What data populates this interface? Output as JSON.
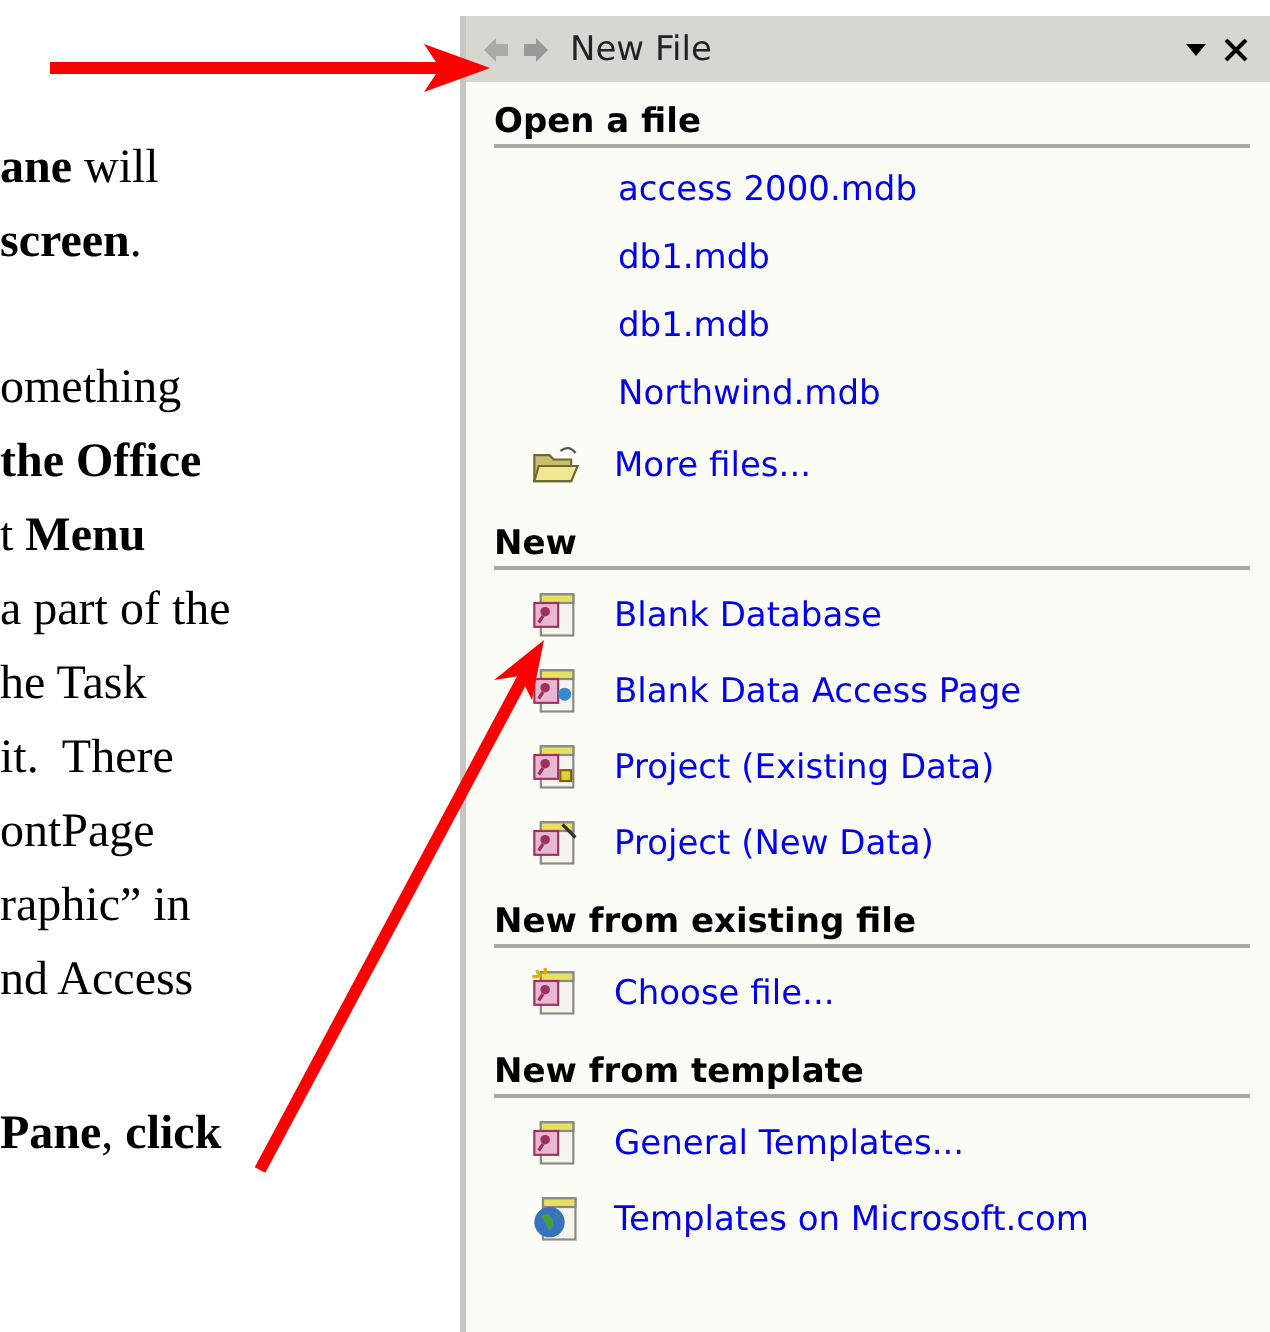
{
  "document": {
    "paragraphs": [
      {
        "lines": [
          "**ane** will",
          "**screen**."
        ]
      },
      {
        "lines": [
          "omething",
          "**the Office**",
          "t **Menu**",
          "a part of the",
          "he Task",
          "it.  There",
          "ontPage",
          "raphic” in",
          "nd Access"
        ]
      },
      {
        "lines": [
          "**Pane**, **click**"
        ]
      }
    ]
  },
  "task_pane": {
    "title": "New File",
    "sections": [
      {
        "heading": "Open a file",
        "items": [
          {
            "label": "access 2000.mdb",
            "kind": "file"
          },
          {
            "label": "db1.mdb",
            "kind": "file"
          },
          {
            "label": "db1.mdb",
            "kind": "file"
          },
          {
            "label": "Northwind.mdb",
            "kind": "file"
          },
          {
            "label": "More files...",
            "kind": "folder"
          }
        ]
      },
      {
        "heading": "New",
        "items": [
          {
            "label": "Blank Database",
            "kind": "database"
          },
          {
            "label": "Blank Data Access Page",
            "kind": "data-page"
          },
          {
            "label": "Project (Existing Data)",
            "kind": "project-existing"
          },
          {
            "label": "Project (New Data)",
            "kind": "project-new"
          }
        ]
      },
      {
        "heading": "New from existing file",
        "items": [
          {
            "label": "Choose file...",
            "kind": "choose-file"
          }
        ]
      },
      {
        "heading": "New from template",
        "items": [
          {
            "label": "General Templates...",
            "kind": "template"
          },
          {
            "label": "Templates on Microsoft.com",
            "kind": "web-template"
          }
        ]
      }
    ]
  }
}
